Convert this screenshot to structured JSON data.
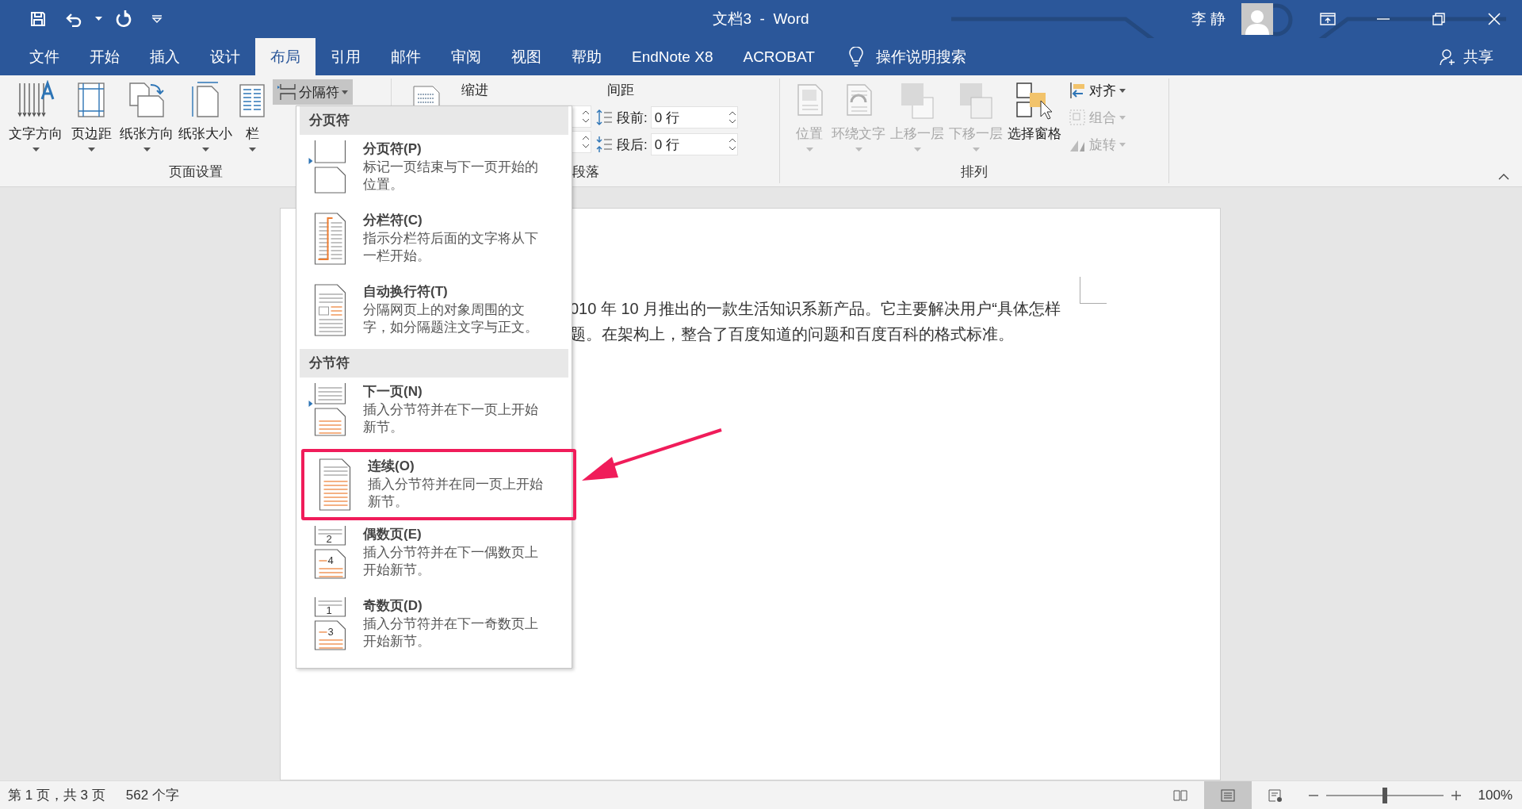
{
  "window": {
    "title": "文档3  -  Word",
    "user": "李 静"
  },
  "quick_access": [
    {
      "kind": "save"
    },
    {
      "kind": "undo"
    },
    {
      "kind": "caret"
    },
    {
      "kind": "redo"
    },
    {
      "kind": "customize"
    }
  ],
  "tabs": [
    {
      "label": "文件",
      "selected": false
    },
    {
      "label": "开始",
      "selected": false
    },
    {
      "label": "插入",
      "selected": false
    },
    {
      "label": "设计",
      "selected": false
    },
    {
      "label": "布局",
      "selected": true
    },
    {
      "label": "引用",
      "selected": false
    },
    {
      "label": "邮件",
      "selected": false
    },
    {
      "label": "审阅",
      "selected": false
    },
    {
      "label": "视图",
      "selected": false
    },
    {
      "label": "帮助",
      "selected": false
    },
    {
      "label": "EndNote X8",
      "selected": false
    },
    {
      "label": "ACROBAT",
      "selected": false
    }
  ],
  "tell_me": {
    "label": "操作说明搜索"
  },
  "share": {
    "label": "共享"
  },
  "ribbon": {
    "page_setup": {
      "label": "页面设置",
      "buttons": [
        {
          "label": "文字方向",
          "kind": "text-direction"
        },
        {
          "label": "页边距",
          "kind": "margins"
        },
        {
          "label": "纸张方向",
          "kind": "orientation"
        },
        {
          "label": "纸张大小",
          "kind": "size"
        },
        {
          "label": "栏",
          "kind": "columns"
        }
      ],
      "breaks": {
        "label": "分隔符",
        "pressed": true
      }
    },
    "paragraph": {
      "label": "段落",
      "indent": "缩进",
      "spacing": "间距",
      "fields": [
        {
          "label": "段前:",
          "value": "0 行",
          "kind": "before"
        },
        {
          "label": "段后:",
          "value": "0 行",
          "kind": "after"
        }
      ]
    },
    "arrange": {
      "label": "排列",
      "buttons": [
        {
          "label": "位置",
          "kind": "position",
          "disabled": true
        },
        {
          "label": "环绕文字",
          "kind": "wrap",
          "disabled": true
        },
        {
          "label": "上移一层",
          "kind": "forward",
          "disabled": true
        },
        {
          "label": "下移一层",
          "kind": "backward",
          "disabled": true
        },
        {
          "label": "选择窗格",
          "kind": "selection-pane",
          "disabled": false
        }
      ],
      "small_buttons": [
        {
          "label": "对齐",
          "kind": "align",
          "disabled": false
        },
        {
          "label": "组合",
          "kind": "group",
          "disabled": true
        },
        {
          "label": "旋转",
          "kind": "rotate",
          "disabled": true
        }
      ]
    }
  },
  "breaks_menu": {
    "sections": [
      {
        "heading": "分页符",
        "items": [
          {
            "title": "分页符(P)",
            "description": "标记一页结束与下一页开始的位置。",
            "kind": "page",
            "highlighted": false
          },
          {
            "title": "分栏符(C)",
            "description": "指示分栏符后面的文字将从下一栏开始。",
            "kind": "column",
            "highlighted": false
          },
          {
            "title": "自动换行符(T)",
            "description": "分隔网页上的对象周围的文字，如分隔题注文字与正文。",
            "kind": "text-wrapping",
            "highlighted": false
          }
        ]
      },
      {
        "heading": "分节符",
        "items": [
          {
            "title": "下一页(N)",
            "description": "插入分节符并在下一页上开始新节。",
            "kind": "next-page",
            "highlighted": false
          },
          {
            "title": "连续(O)",
            "description": "插入分节符并在同一页上开始新节。",
            "kind": "continuous",
            "highlighted": true
          },
          {
            "title": "偶数页(E)",
            "description": "插入分节符并在下一偶数页上开始新节。",
            "kind": "numbered-page",
            "page_numbers": [
              "2",
              "4"
            ],
            "highlighted": false
          },
          {
            "title": "奇数页(D)",
            "description": "插入分节符并在下一奇数页上开始新节。",
            "kind": "numbered-page",
            "page_numbers": [
              "1",
              "3"
            ],
            "highlighted": false
          }
        ]
      }
    ]
  },
  "document": {
    "lines": [
      "010 年 10 月推出的一款生活知识系新产品。它主要解决用户“具体怎样",
      "题。在架构上，整合了百度知道的问题和百度百科的格式标准。"
    ]
  },
  "status_bar": {
    "page": "第 1 页，共 3 页",
    "words": "562 个字",
    "views": [
      {
        "kind": "read",
        "selected": false
      },
      {
        "kind": "print",
        "selected": true
      },
      {
        "kind": "web",
        "selected": false
      }
    ],
    "zoom": {
      "level": 0.5,
      "reading": "100%"
    }
  }
}
